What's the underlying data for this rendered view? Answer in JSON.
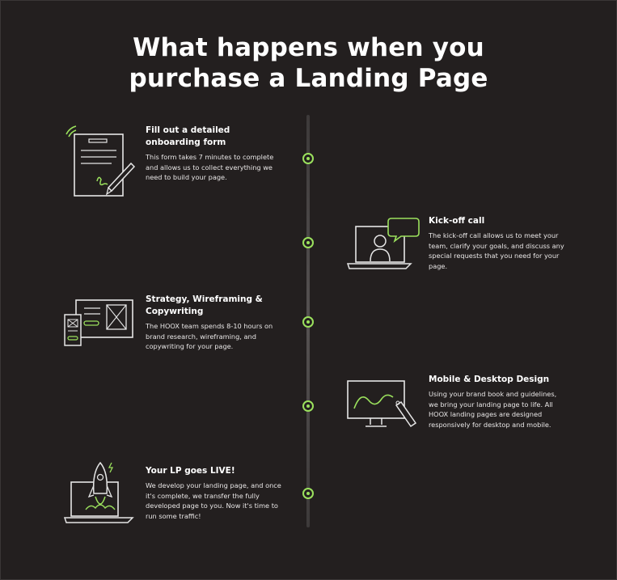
{
  "title": {
    "line1": "What happens when you",
    "line2": "purchase a Landing Page"
  },
  "colors": {
    "background": "#231f1f",
    "accent": "#9be15d",
    "text": "#ffffff"
  },
  "steps": [
    {
      "heading": "Fill out a detailed onboarding form",
      "body": "This form takes 7 minutes to complete and allows us to collect everything we need to build your page.",
      "icon": "form-signature-icon"
    },
    {
      "heading": "Kick-off call",
      "body": "The kick-off call allows us to meet your team, clarify your goals, and discuss any special requests that you need for your page.",
      "icon": "laptop-video-call-icon"
    },
    {
      "heading": "Strategy, Wireframing & Copywriting",
      "body": "The HOOX team spends 8-10 hours on brand research, wireframing, and copywriting for your page.",
      "icon": "wireframe-icon"
    },
    {
      "heading": "Mobile & Desktop Design",
      "body": "Using your brand book and guidelines, we bring your landing page to life. All HOOX landing pages are designed responsively for desktop and mobile.",
      "icon": "monitor-pen-icon"
    },
    {
      "heading": "Your LP goes LIVE!",
      "body": "We develop your landing page, and once it's complete, we transfer the fully developed page to you. Now it's time to run some traffic!",
      "icon": "laptop-rocket-icon"
    }
  ]
}
